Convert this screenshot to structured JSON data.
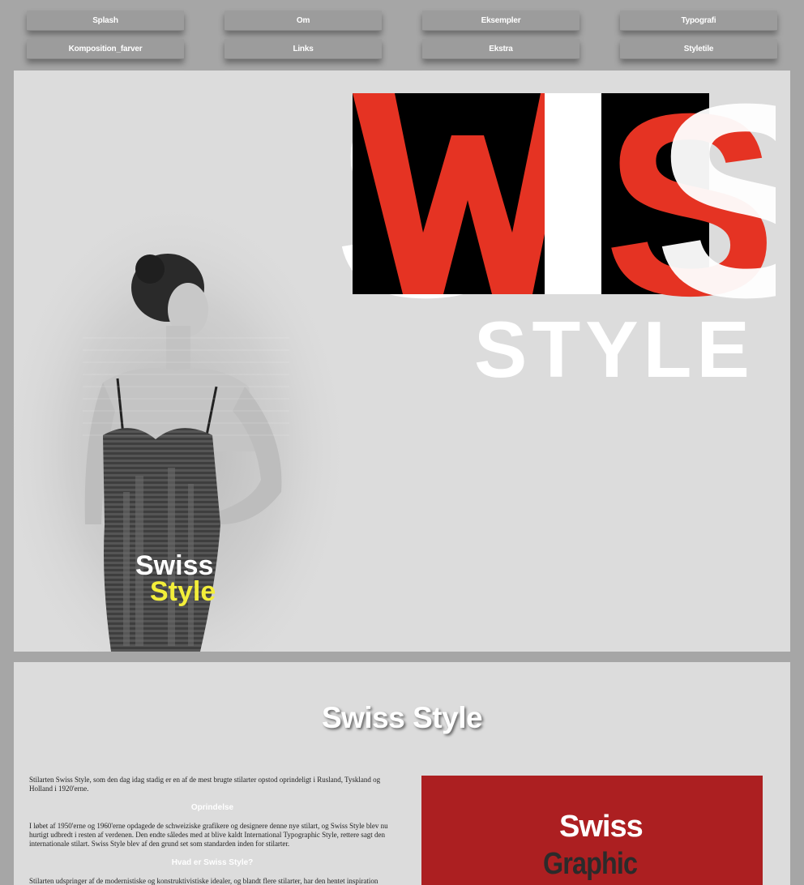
{
  "nav": {
    "items": [
      {
        "label": "Splash"
      },
      {
        "label": "Om"
      },
      {
        "label": "Eksempler"
      },
      {
        "label": "Typografi"
      },
      {
        "label": "Komposition_farver"
      },
      {
        "label": "Links"
      },
      {
        "label": "Ekstra"
      },
      {
        "label": "Styletile"
      }
    ]
  },
  "hero": {
    "logo_big_letters": "SWIS",
    "logo_subtitle": "STYLE",
    "image_caption_line1": "Swiss",
    "image_caption_line2": "Style"
  },
  "content": {
    "title": "Swiss Style",
    "para1": "Stilarten Swiss Style, som den dag idag stadig er en af de mest brugte stilarter opstod oprindeligt i Rusland, Tyskland og Holland i 1920'erne.",
    "heading1": "Oprindelse",
    "para2": "I løbet af 1950'erne og 1960'erne opdagede de schweiziske grafikere og designere denne nye stilart, og Swiss Style blev nu hurtigt udbredt i resten af verdenen. Den endte således med at blive kaldt International Typographic Style, rettere sagt den internationale stilart. Swiss Style blev af den grund set som standarden inden for stilarter.",
    "heading2": "Hvad er Swiss Style?",
    "para3": "Stilarten udspringer af de modernistiske og konstruktivistiske idealer, og blandt flere stilarter, har den hentet inspiration",
    "graphic_word1": "Swiss",
    "graphic_word2": "Graphic"
  },
  "colors": {
    "page_bg": "#a6a6a6",
    "panel_bg": "#dcdcdc",
    "logo_red": "#e53323",
    "logo_black": "#000000",
    "caption_yellow": "#f3ee3a",
    "graphic_red": "#ac1f21"
  }
}
